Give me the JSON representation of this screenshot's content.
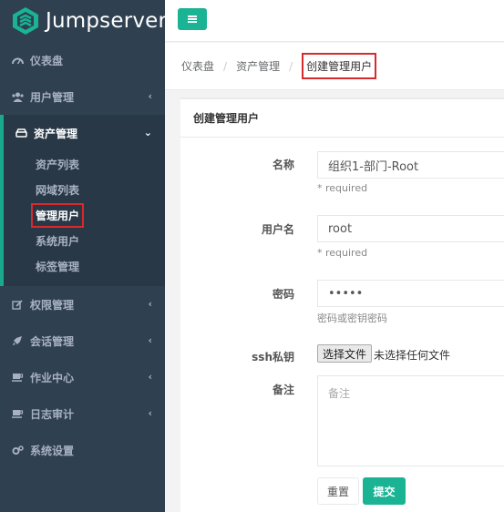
{
  "app": {
    "name": "Jumpserver"
  },
  "colors": {
    "sidebar": "#2f4050",
    "accent": "#1ab394",
    "highlight": "#d9292c"
  },
  "sidebar": {
    "items": [
      {
        "label": "仪表盘",
        "icon": "dashboard-icon"
      },
      {
        "label": "用户管理",
        "icon": "users-icon"
      },
      {
        "label": "资产管理",
        "icon": "hdd-icon",
        "expanded": true,
        "children": [
          "资产列表",
          "网域列表",
          "管理用户",
          "系统用户",
          "标签管理"
        ]
      },
      {
        "label": "权限管理",
        "icon": "edit-icon"
      },
      {
        "label": "会话管理",
        "icon": "rocket-icon"
      },
      {
        "label": "作业中心",
        "icon": "coffee-icon"
      },
      {
        "label": "日志审计",
        "icon": "coffee-icon"
      },
      {
        "label": "系统设置",
        "icon": "gears-icon"
      }
    ]
  },
  "breadcrumb": [
    "仪表盘",
    "资产管理",
    "创建管理用户"
  ],
  "form": {
    "title": "创建管理用户",
    "name_label": "名称",
    "name_value": "组织1-部门-Root",
    "required": "* required",
    "username_label": "用户名",
    "username_value": "root",
    "password_label": "密码",
    "password_value": "•••••",
    "password_help": "密码或密钥密码",
    "ssh_label": "ssh私钥",
    "file_button": "选择文件",
    "file_note": "未选择任何文件",
    "comment_label": "备注",
    "comment_placeholder": "备注",
    "reset": "重置",
    "submit": "提交"
  }
}
